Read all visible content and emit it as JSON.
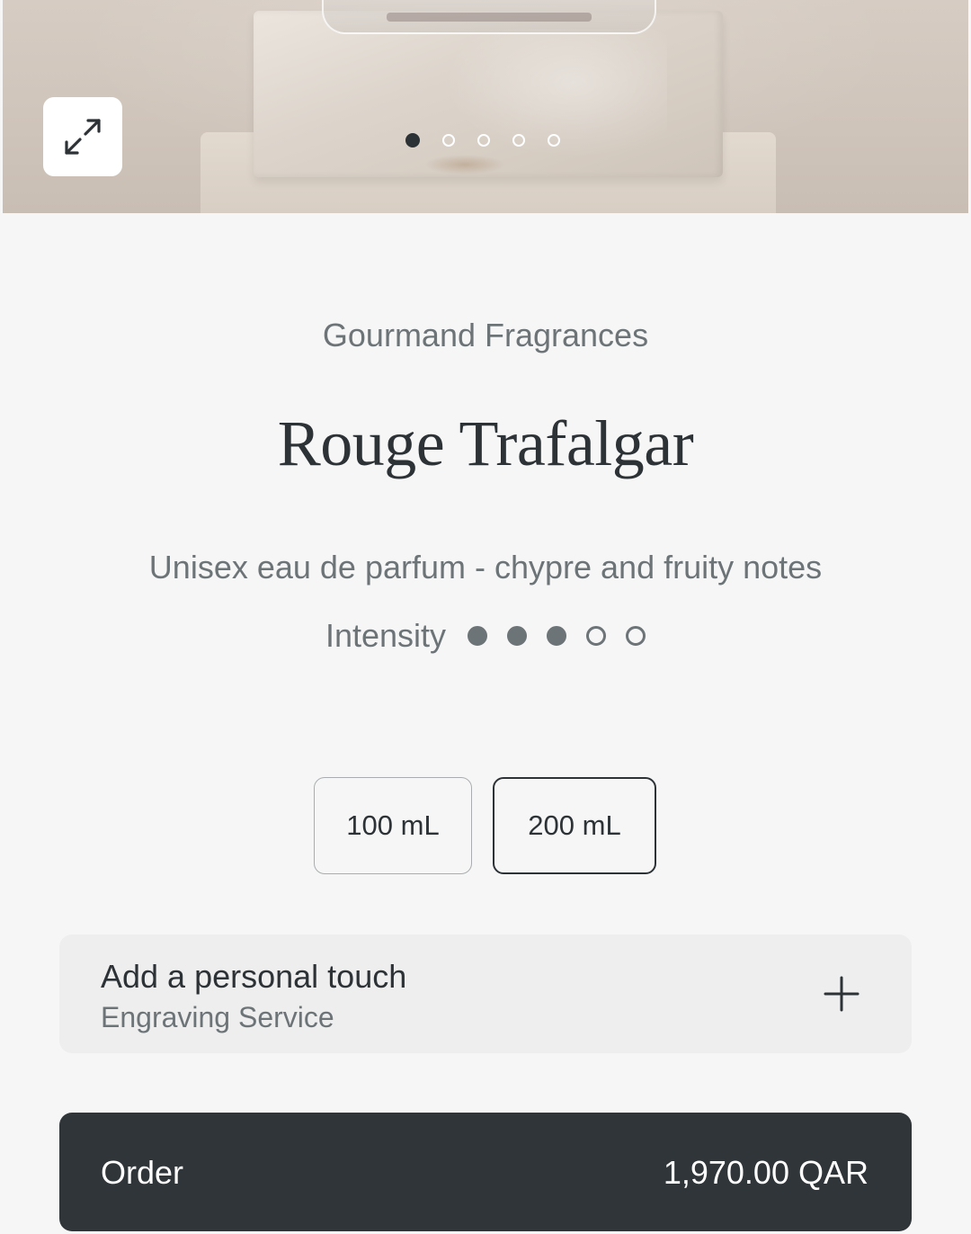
{
  "product": {
    "category": "Gourmand Fragrances",
    "name": "Rouge Trafalgar",
    "description": "Unisex eau de parfum - chypre and fruity notes",
    "intensity_label": "Intensity",
    "intensity_level": 3,
    "intensity_max": 5
  },
  "gallery": {
    "image_count": 5,
    "active_index": 0,
    "expand_icon": "expand-arrows-icon"
  },
  "sizes": {
    "options": [
      "100 mL",
      "200 mL"
    ],
    "selected": "200 mL"
  },
  "personal_touch": {
    "title": "Add a personal touch",
    "subtitle": "Engraving Service",
    "icon": "plus-icon"
  },
  "order": {
    "label": "Order",
    "price": "1,970.00 QAR"
  },
  "colors": {
    "background": "#f6f6f6",
    "text_primary": "#2c3236",
    "text_secondary": "#6d7478",
    "order_button": "#2f3539"
  }
}
